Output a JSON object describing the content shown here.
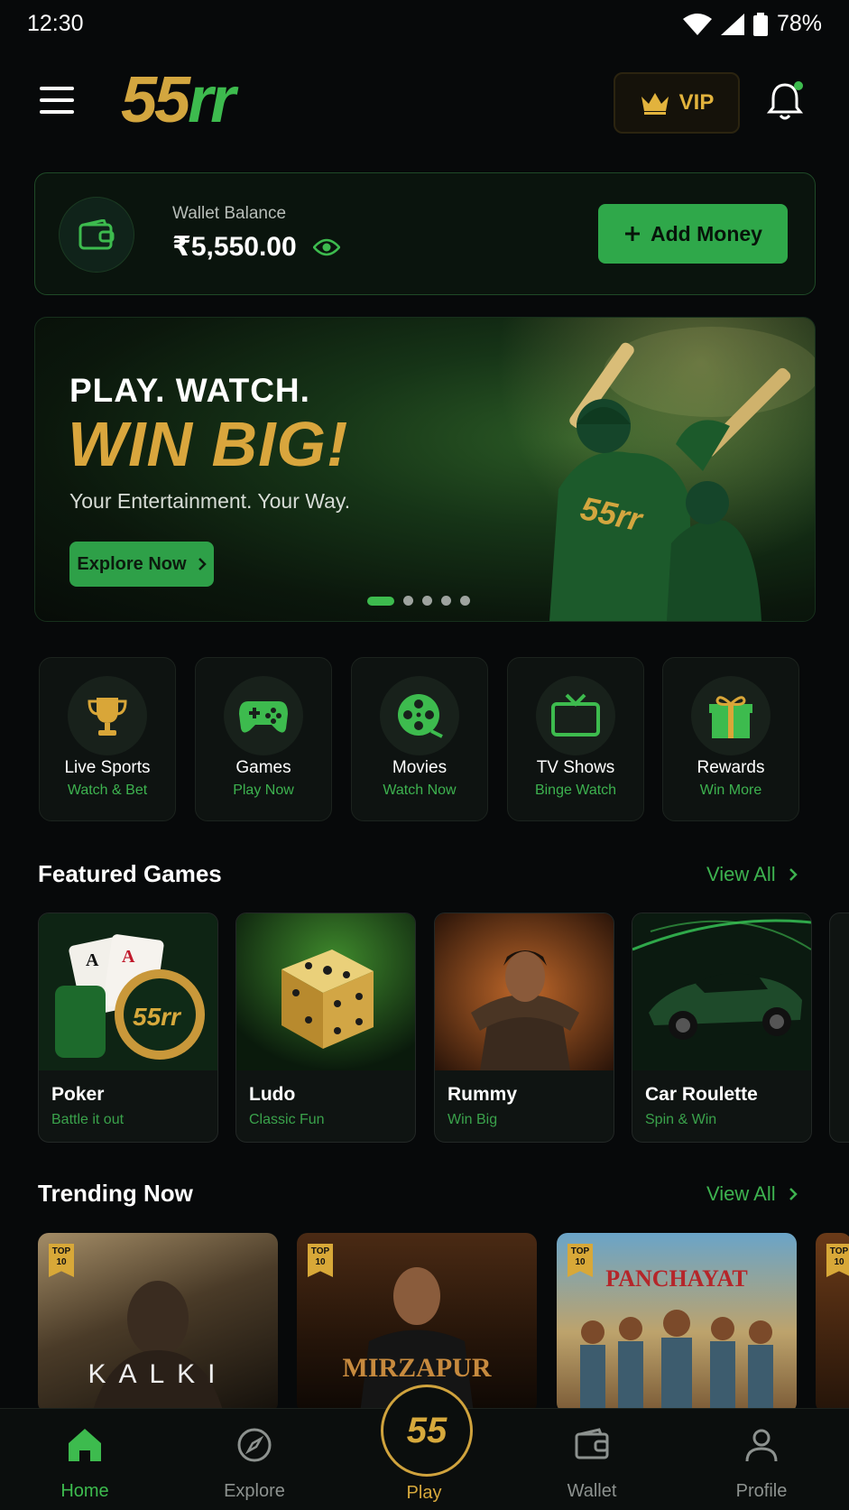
{
  "status_bar": {
    "time": "12:30",
    "battery": "78%"
  },
  "header": {
    "logo_num": "55",
    "logo_txt": "rr",
    "vip_label": "VIP"
  },
  "wallet": {
    "label": "Wallet Balance",
    "amount": "₹5,550.00",
    "add_label": "Add Money"
  },
  "banner": {
    "line1": "PLAY. WATCH.",
    "line2": "WIN BIG!",
    "line3": "Your Entertainment. Your Way.",
    "cta": "Explore Now",
    "jersey_text": "55rr",
    "slides": 5,
    "active_slide": 1
  },
  "categories": [
    {
      "name": "Live Sports",
      "sub": "Watch & Bet",
      "icon": "trophy-icon"
    },
    {
      "name": "Games",
      "sub": "Play Now",
      "icon": "gamepad-icon"
    },
    {
      "name": "Movies",
      "sub": "Watch Now",
      "icon": "film-reel-icon"
    },
    {
      "name": "TV Shows",
      "sub": "Binge Watch",
      "icon": "tv-icon"
    },
    {
      "name": "Rewards",
      "sub": "Win More",
      "icon": "gift-icon"
    }
  ],
  "featured": {
    "title": "Featured Games",
    "view_all": "View All",
    "items": [
      {
        "name": "Poker",
        "sub": "Battle it out",
        "chip_text": "55rr"
      },
      {
        "name": "Ludo",
        "sub": "Classic Fun"
      },
      {
        "name": "Rummy",
        "sub": "Win Big"
      },
      {
        "name": "Car Roulette",
        "sub": "Spin & Win"
      }
    ]
  },
  "trending": {
    "title": "Trending Now",
    "view_all": "View All",
    "badge": "TOP 10",
    "items": [
      {
        "title": "KALKI"
      },
      {
        "title": "MIRZAPUR"
      },
      {
        "title": "PANCHAYAT"
      }
    ]
  },
  "nav": {
    "home": "Home",
    "explore": "Explore",
    "play": "Play",
    "play_logo": "55",
    "wallet": "Wallet",
    "profile": "Profile"
  },
  "colors": {
    "accent_green": "#3dbb4e",
    "gold": "#d7a93c",
    "background": "#07090a"
  }
}
